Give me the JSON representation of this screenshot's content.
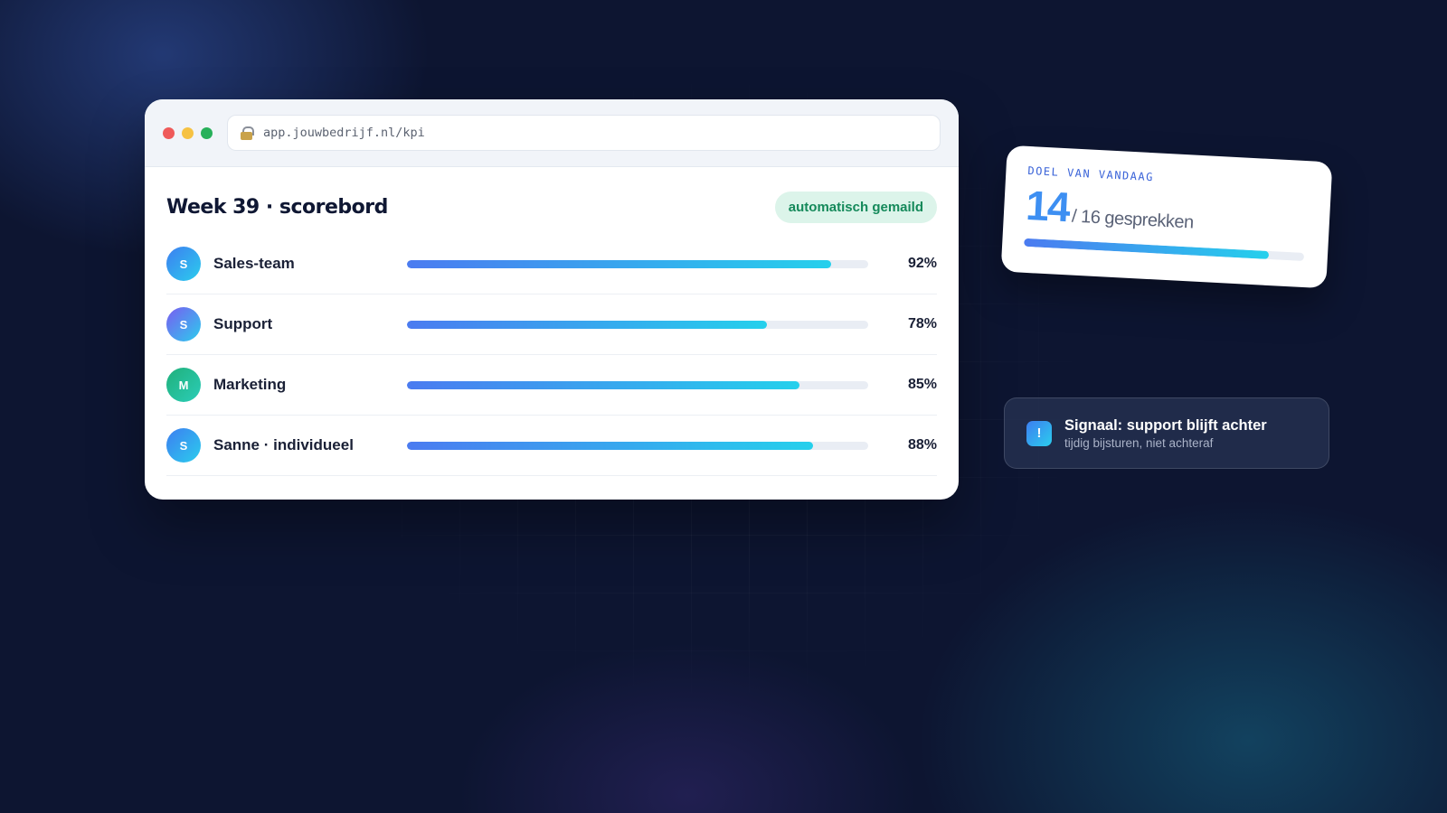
{
  "browser": {
    "url": "app.jouwbedrijf.nl/kpi",
    "window_dots": [
      {
        "name": "close",
        "color": "#ef5a5a"
      },
      {
        "name": "minimize",
        "color": "#f6c243"
      },
      {
        "name": "maximize",
        "color": "#27b05a"
      }
    ]
  },
  "scoreboard": {
    "title": "Week 39 · scorebord",
    "badge": "automatisch gemaild",
    "rows": [
      {
        "initial": "S",
        "label": "Sales-team",
        "value": 92,
        "value_label": "92%",
        "avatar_colors": [
          "#3d7ef0",
          "#2bcdee"
        ]
      },
      {
        "initial": "S",
        "label": "Support",
        "value": 78,
        "value_label": "78%",
        "avatar_colors": [
          "#7a5cf0",
          "#2bcdee"
        ]
      },
      {
        "initial": "M",
        "label": "Marketing",
        "value": 85,
        "value_label": "85%",
        "avatar_colors": [
          "#20b07a",
          "#2bcdb8"
        ]
      },
      {
        "initial": "S",
        "label": "Sanne · individueel",
        "value": 88,
        "value_label": "88%",
        "avatar_colors": [
          "#3d7ef0",
          "#2bcdee"
        ]
      }
    ]
  },
  "goal": {
    "label": "DOEL VAN VANDAAG",
    "current": "14",
    "rest": "/ 16 gesprekken",
    "progress": 0.875
  },
  "signal": {
    "icon": "!",
    "title": "Signaal: support blijft achter",
    "subtitle": "tijdig bijsturen, niet achteraf"
  }
}
